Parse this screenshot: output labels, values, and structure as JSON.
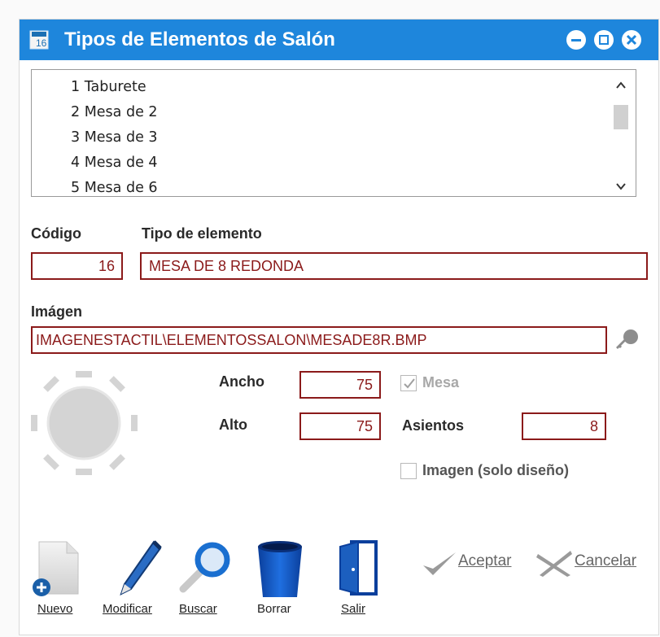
{
  "window": {
    "title": "Tipos de Elementos de Salón",
    "title_bar_color": "#1e86dc",
    "icons": [
      "app-icon",
      "minimize-icon",
      "maximize-icon",
      "close-icon"
    ]
  },
  "list": {
    "items": [
      "1 Taburete",
      "2 Mesa de 2",
      "3 Mesa de 3",
      "4 Mesa de 4",
      "5 Mesa de 6"
    ]
  },
  "form": {
    "codigo_label": "Código",
    "codigo_value": "16",
    "tipo_label": "Tipo de elemento",
    "tipo_value": "MESA DE 8 REDONDA",
    "imagen_label": "Imágen",
    "imagen_value": "IMAGENESTACTIL\\ELEMENTOSSALON\\MESADE8R.BMP",
    "ancho_label": "Ancho",
    "ancho_value": "75",
    "alto_label": "Alto",
    "alto_value": "75",
    "mesa_label": "Mesa",
    "mesa_checked": true,
    "asientos_label": "Asientos",
    "asientos_value": "8",
    "imagen_solo_label": "Imagen (solo diseño)",
    "imagen_solo_checked": false
  },
  "toolbar": {
    "nuevo": "Nuevo",
    "modificar": "Modificar",
    "buscar": "Buscar",
    "borrar": "Borrar",
    "salir": "Salir"
  },
  "actions": {
    "aceptar": "Aceptar",
    "cancelar": "Cancelar"
  },
  "colors": {
    "field_border": "#8b1a1a",
    "field_text": "#8b1a1a",
    "accent": "#1e86dc"
  }
}
